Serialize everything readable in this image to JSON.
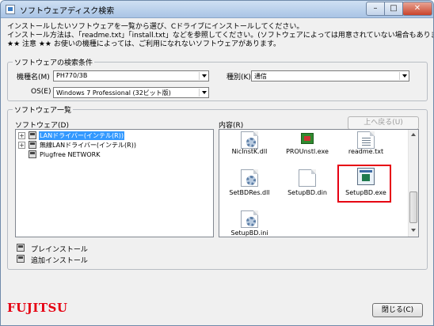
{
  "window": {
    "title": "ソフトウェアディスク検索",
    "controls": {
      "minimize": "–",
      "maximize": "□",
      "close": "✕"
    }
  },
  "instructions": [
    "インストールしたいソフトウェアを一覧から選び、Cドライブにインストールしてください。",
    "インストール方法は、「readme.txt」「install.txt」などを参照してください。(ソフトウェアによっては用意されていない場合もあります)",
    "★★ 注意 ★★ お使いの機種によっては、ご利用になれないソフトウェアがあります。"
  ],
  "search": {
    "legend": "ソフトウェアの検索条件",
    "model_label": "機種名(M)",
    "model_value": "PH770/3B",
    "os_label": "OS(E)",
    "os_value": "Windows 7 Professional (32ビット版)",
    "type_label": "種別(K)",
    "type_value": "通信"
  },
  "list": {
    "legend": "ソフトウェア一覧",
    "software_label": "ソフトウェア(D)",
    "contents_label": "内容(R)",
    "up_button": "上へ戻る(U)",
    "tree": [
      {
        "label": "LANドライバー(インテル(R))",
        "selected": true,
        "expandable": true
      },
      {
        "label": "無線LANドライバー(インテル(R))",
        "selected": false,
        "expandable": true
      },
      {
        "label": "Plugfree NETWORK",
        "selected": false,
        "expandable": false
      }
    ],
    "files": [
      {
        "name": "NicInstK.dll",
        "icon": "dll-file-icon"
      },
      {
        "name": "PROUnstl.exe",
        "icon": "chip-exe-icon"
      },
      {
        "name": "readme.txt",
        "icon": "text-file-icon"
      },
      {
        "name": "SetBDRes.dll",
        "icon": "dll-file-icon"
      },
      {
        "name": "SetupBD.din",
        "icon": "blank-file-icon"
      },
      {
        "name": "SetupBD.exe",
        "icon": "exe-file-icon",
        "highlighted": true
      },
      {
        "name": "SetupBD.ini",
        "icon": "ini-file-icon"
      }
    ]
  },
  "legend": {
    "preinstall": "プレインストール",
    "additional": "追加インストール"
  },
  "footer": {
    "brand": "FUJITSU",
    "close_button": "閉じる(C)"
  },
  "colors": {
    "highlight": "#e60012",
    "brand": "#e60012",
    "selection": "#3399ff"
  }
}
